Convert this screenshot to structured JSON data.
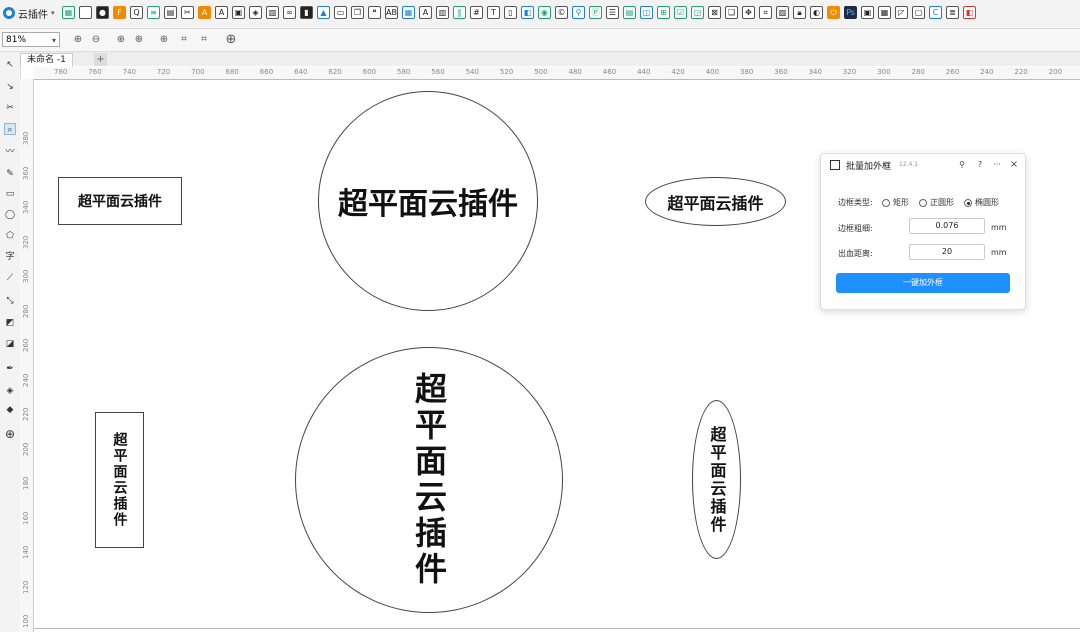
{
  "app": {
    "plugin_menu_label": "云插件"
  },
  "toolbar": {
    "zoom_value": "81%"
  },
  "document": {
    "tab_name": "未命名 -1",
    "tab_add": "+"
  },
  "ruler": {
    "h_ticks": [
      "780",
      "760",
      "740",
      "720",
      "700",
      "680",
      "660",
      "640",
      "620",
      "600",
      "580",
      "560",
      "540",
      "520",
      "500",
      "480",
      "460",
      "440",
      "420",
      "400",
      "380",
      "360",
      "340",
      "320",
      "300",
      "280",
      "260",
      "240",
      "220",
      "200"
    ],
    "v_ticks": [
      "380",
      "360",
      "340",
      "320",
      "300",
      "280",
      "260",
      "240",
      "220",
      "200",
      "180",
      "160",
      "140",
      "120",
      "100"
    ]
  },
  "canvas_shapes": [
    {
      "id": "rect-horizontal",
      "text": "超平面云插件"
    },
    {
      "id": "circle-horizontal",
      "text": "超平面云插件"
    },
    {
      "id": "ellipse-horizontal",
      "text": "超平面云插件"
    },
    {
      "id": "rect-vertical",
      "text": "超平面云插件"
    },
    {
      "id": "circle-vertical",
      "text": "超平面云插件"
    },
    {
      "id": "ellipse-vertical",
      "text": "超平面云插件"
    }
  ],
  "panel": {
    "title": "批量加外框",
    "version": "12.4.1",
    "pin_icon": "pin-icon",
    "help_label": "?",
    "more_label": "···",
    "close_label": "×",
    "frame_type_label": "边框类型:",
    "frame_types": [
      "矩形",
      "正圆形",
      "椭圆形"
    ],
    "selected_frame_type": "椭圆形",
    "stroke_label": "边框粗细:",
    "stroke_value": "0.076",
    "stroke_unit": "mm",
    "bleed_label": "出血距离:",
    "bleed_value": "20",
    "bleed_unit": "mm",
    "apply_label": "一键加外框"
  },
  "colors": {
    "accent": "#1e90ff",
    "plugin_blue": "#1c7fd8",
    "ruler_line": "#9cc3e8"
  }
}
